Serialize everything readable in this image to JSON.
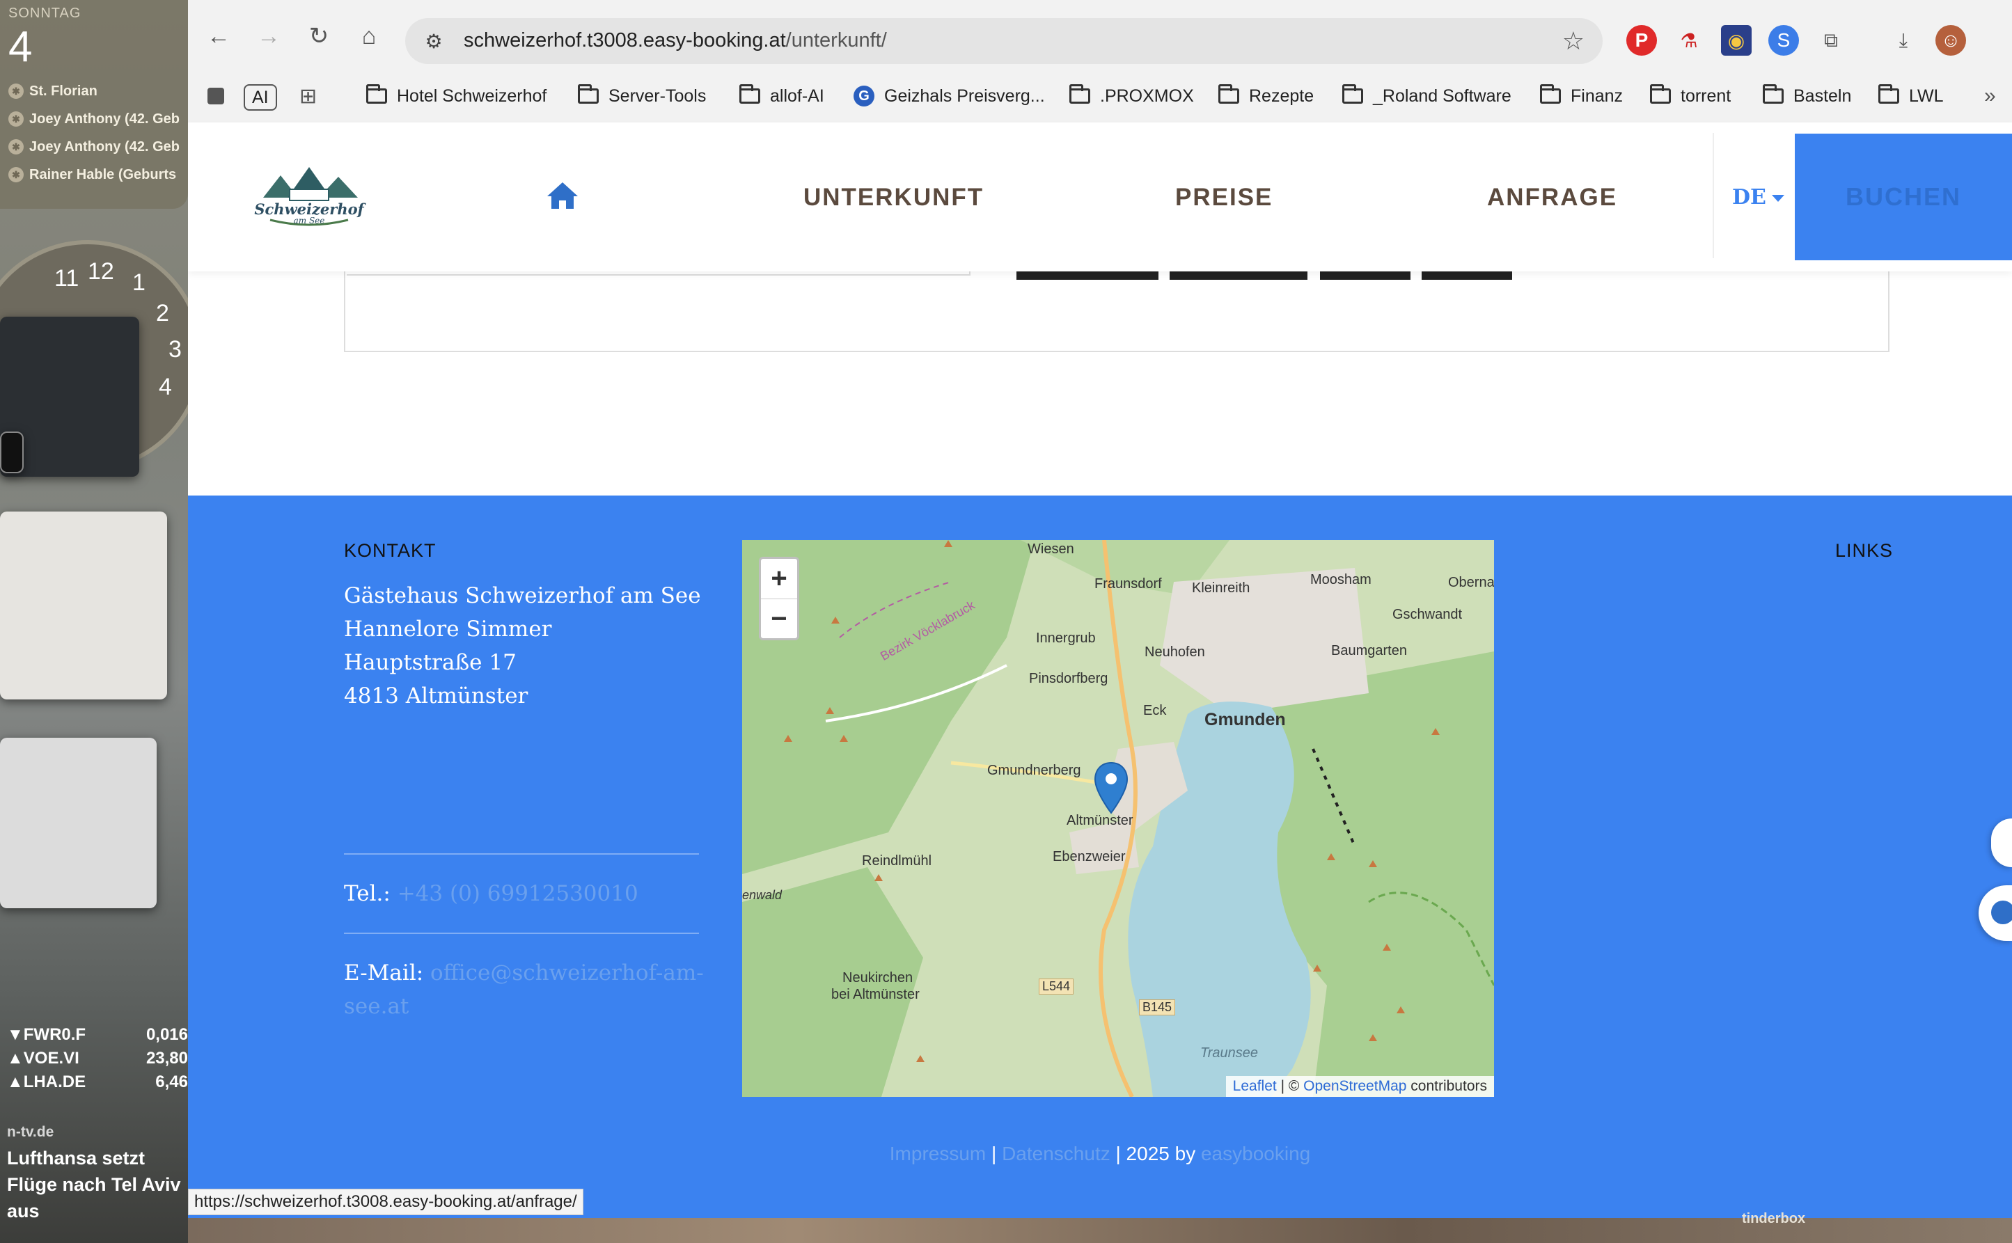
{
  "desktop": {
    "calendar": {
      "weekday": "SONNTAG",
      "day": "4",
      "events": [
        "St. Florian",
        "Joey Anthony (42. Geb",
        "Joey Anthony (42. Geb",
        "Rainer Hable (Geburts"
      ]
    },
    "clock_numbers": [
      "11",
      "12",
      "1",
      "2",
      "3",
      "4"
    ],
    "stocks": [
      {
        "arrow": "▼",
        "symbol": "FWR0.F",
        "value": "0,016"
      },
      {
        "arrow": "▲",
        "symbol": "VOE.VI",
        "value": "23,80"
      },
      {
        "arrow": "▲",
        "symbol": "LHA.DE",
        "value": "6,46"
      }
    ],
    "news": {
      "source": "n-tv.de",
      "headline": "Lufthansa setzt Flüge nach Tel Aviv aus"
    },
    "dock_label": "tinderbox"
  },
  "browser": {
    "url_host": "schweizerhof.t3008.easy-booking.at",
    "url_path": "/unterkunft/",
    "status_url": "https://schweizerhof.t3008.easy-booking.at/anfrage/",
    "ai_label": "AI",
    "bookmarks": [
      "Hotel Schweizerhof",
      "Server-Tools",
      "allof-AI",
      "Geizhals Preisverg...",
      ".PROXMOX",
      "Rezepte",
      "_Roland Software",
      "Finanz",
      "torrent",
      "Basteln",
      "LWL"
    ]
  },
  "site": {
    "logo_text": "Schweizerhof",
    "logo_sub": "am See",
    "nav": [
      "UNTERKUNFT",
      "PREISE",
      "ANFRAGE"
    ],
    "lang": "DE",
    "book": "BUCHEN",
    "footer": {
      "contact_heading": "KONTAKT",
      "links_heading": "LINKS",
      "address": [
        "Gästehaus Schweizerhof am See",
        "Hannelore Simmer",
        "Hauptstraße 17",
        "4813 Altmünster"
      ],
      "tel_label": "Tel.:",
      "tel_value": "+43 (0) 69912530010",
      "email_label": "E-Mail:",
      "email_value": "office@schweizerhof-am-see.at",
      "bottom": {
        "impressum": "Impressum",
        "sep1": " | ",
        "datenschutz": "Datenschutz",
        "copy": " | 2025 by ",
        "easybooking": "easybooking"
      }
    },
    "map": {
      "zoom_in": "+",
      "zoom_out": "−",
      "places": [
        "Wiesen",
        "Fraunsdorf",
        "Kleinreith",
        "Moosham",
        "Oberna",
        "Gschwandt",
        "Innergrub",
        "Neuhofen",
        "Baumgarten",
        "Pinsdorfberg",
        "Eck",
        "Gmunden",
        "Gmundnerberg",
        "Altmünster",
        "Reindlmühl",
        "Ebenzweier",
        "Neukirchen",
        "bei Altmünster",
        "L544",
        "B145",
        "Traunsee",
        "Bezirk Vöcklabruck",
        "enwald"
      ],
      "attribution_leaflet": "Leaflet",
      "attribution_mid": " | © ",
      "attribution_osm": "OpenStreetMap",
      "attribution_end": " contributors"
    }
  }
}
